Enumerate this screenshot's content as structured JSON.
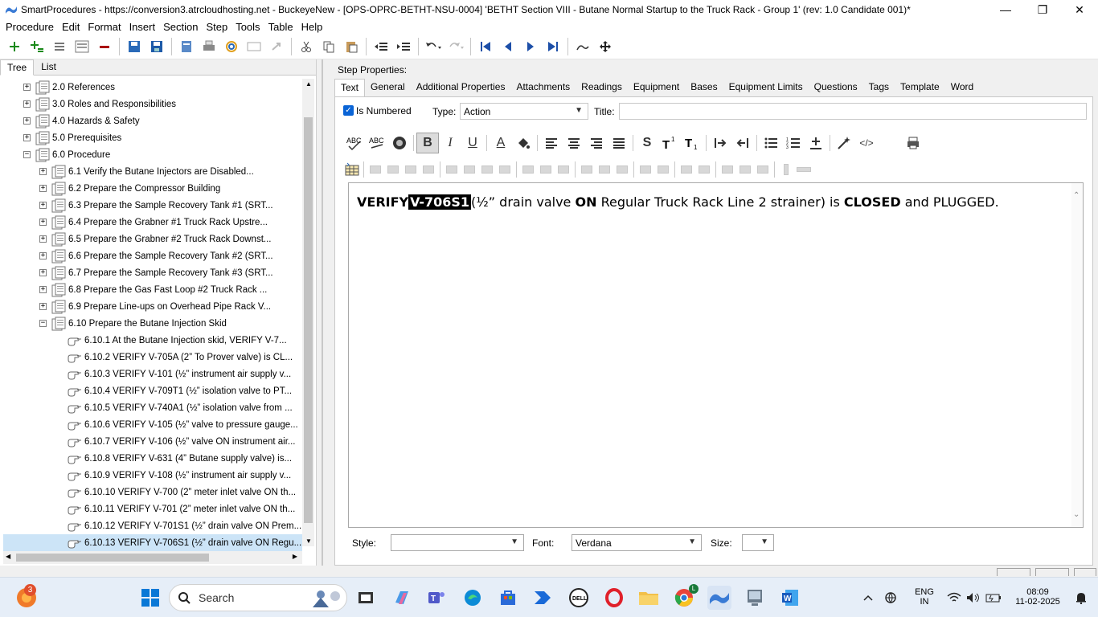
{
  "window": {
    "title": "SmartProcedures - https://conversion3.atrcloudhosting.net - BuckeyeNew - [OPS-OPRC-BETHT-NSU-0004] 'BETHT Section VIII - Butane Normal Startup to the Truck Rack - Group 1' (rev: 1.0 Candidate 001)*",
    "minimize": "—",
    "restore": "❐",
    "close": "✕"
  },
  "menu": [
    {
      "label": "Procedure"
    },
    {
      "label": "Edit"
    },
    {
      "label": "Format"
    },
    {
      "label": "Insert"
    },
    {
      "label": "Section"
    },
    {
      "label": "Step"
    },
    {
      "label": "Tools"
    },
    {
      "label": "Table"
    },
    {
      "label": "Help"
    }
  ],
  "left_tabs": [
    {
      "label": "Tree",
      "active": true
    },
    {
      "label": "List",
      "active": false
    }
  ],
  "tree": [
    {
      "indent": 0,
      "exp": "+",
      "label": "2.0 References",
      "kind": "doc"
    },
    {
      "indent": 0,
      "exp": "+",
      "label": "3.0 Roles and Responsibilities",
      "kind": "doc"
    },
    {
      "indent": 0,
      "exp": "+",
      "label": "4.0 Hazards & Safety",
      "kind": "doc"
    },
    {
      "indent": 0,
      "exp": "+",
      "label": "5.0 Prerequisites",
      "kind": "doc"
    },
    {
      "indent": 0,
      "exp": "−",
      "label": "6.0 Procedure",
      "kind": "doc"
    },
    {
      "indent": 1,
      "exp": "+",
      "label": "6.1 Verify the Butane Injectors are Disabled...",
      "kind": "doc"
    },
    {
      "indent": 1,
      "exp": "+",
      "label": "6.2 Prepare the Compressor Building",
      "kind": "doc"
    },
    {
      "indent": 1,
      "exp": "+",
      "label": "6.3 Prepare the Sample Recovery Tank #1 (SRT...",
      "kind": "doc"
    },
    {
      "indent": 1,
      "exp": "+",
      "label": "6.4 Prepare the Grabner #1 Truck Rack Upstre...",
      "kind": "doc"
    },
    {
      "indent": 1,
      "exp": "+",
      "label": "6.5 Prepare the Grabner #2 Truck Rack Downst...",
      "kind": "doc"
    },
    {
      "indent": 1,
      "exp": "+",
      "label": "6.6 Prepare the Sample Recovery Tank #2 (SRT...",
      "kind": "doc"
    },
    {
      "indent": 1,
      "exp": "+",
      "label": "6.7 Prepare the Sample Recovery Tank #3 (SRT...",
      "kind": "doc"
    },
    {
      "indent": 1,
      "exp": "+",
      "label": "6.8 Prepare the Gas Fast Loop #2 Truck Rack ...",
      "kind": "doc"
    },
    {
      "indent": 1,
      "exp": "+",
      "label": "6.9 Prepare Line-ups on Overhead Pipe Rack V...",
      "kind": "doc"
    },
    {
      "indent": 1,
      "exp": "−",
      "label": "6.10 Prepare the Butane Injection Skid",
      "kind": "doc"
    },
    {
      "indent": 2,
      "exp": "",
      "label": "6.10.1 At the Butane Injection skid, VERIFY V-7...",
      "kind": "hand"
    },
    {
      "indent": 2,
      "exp": "",
      "label": "6.10.2 VERIFY V-705A (2” To Prover valve) is CL...",
      "kind": "hand"
    },
    {
      "indent": 2,
      "exp": "",
      "label": "6.10.3 VERIFY V-101 (½” instrument air supply v...",
      "kind": "hand"
    },
    {
      "indent": 2,
      "exp": "",
      "label": "6.10.4 VERIFY V-709T1 (½” isolation valve to PT...",
      "kind": "hand"
    },
    {
      "indent": 2,
      "exp": "",
      "label": "6.10.5 VERIFY V-740A1 (½” isolation valve from ...",
      "kind": "hand"
    },
    {
      "indent": 2,
      "exp": "",
      "label": "6.10.6 VERIFY V-105 (½” valve to pressure gauge...",
      "kind": "hand"
    },
    {
      "indent": 2,
      "exp": "",
      "label": "6.10.7 VERIFY V-106 (½” valve ON instrument air...",
      "kind": "hand"
    },
    {
      "indent": 2,
      "exp": "",
      "label": "6.10.8 VERIFY V-631 (4” Butane supply valve) is...",
      "kind": "hand"
    },
    {
      "indent": 2,
      "exp": "",
      "label": "6.10.9 VERIFY V-108 (½” instrument air supply v...",
      "kind": "hand"
    },
    {
      "indent": 2,
      "exp": "",
      "label": "6.10.10 VERIFY V-700 (2” meter inlet valve ON th...",
      "kind": "hand"
    },
    {
      "indent": 2,
      "exp": "",
      "label": "6.10.11 VERIFY V-701 (2” meter inlet valve ON th...",
      "kind": "hand"
    },
    {
      "indent": 2,
      "exp": "",
      "label": "6.10.12 VERIFY V-701S1 (½” drain valve ON Prem...",
      "kind": "hand"
    },
    {
      "indent": 2,
      "exp": "",
      "label": "6.10.13 VERIFY V-706S1 (½” drain valve ON Regu...",
      "kind": "hand",
      "selected": true
    }
  ],
  "step_properties": {
    "label": "Step Properties:",
    "tabs": [
      {
        "label": "Text",
        "active": true
      },
      {
        "label": "General"
      },
      {
        "label": "Additional Properties"
      },
      {
        "label": "Attachments"
      },
      {
        "label": "Readings"
      },
      {
        "label": "Equipment"
      },
      {
        "label": "Bases"
      },
      {
        "label": "Equipment Limits"
      },
      {
        "label": "Questions"
      },
      {
        "label": "Tags"
      },
      {
        "label": "Template"
      },
      {
        "label": "Word"
      }
    ],
    "is_numbered_label": "Is Numbered",
    "is_numbered": true,
    "type_label": "Type:",
    "type_value": "Action",
    "title_label": "Title:",
    "title_value": ""
  },
  "editor": {
    "parts": [
      {
        "text": "VERIFY",
        "style": "bold"
      },
      {
        "text": "V-706S1",
        "style": "highlight"
      },
      {
        "text": "(½” drain valve ",
        "style": "normal"
      },
      {
        "text": "ON",
        "style": "bold"
      },
      {
        "text": " Regular Truck Rack Line 2 strainer) is ",
        "style": "normal"
      },
      {
        "text": "CLOSED",
        "style": "bold"
      },
      {
        "text": " and PLUGGED.",
        "style": "normal"
      }
    ]
  },
  "bottom_fields": {
    "style_label": "Style:",
    "style_value": "",
    "font_label": "Font:",
    "font_value": "Verdana",
    "size_label": "Size:",
    "size_value": ""
  },
  "taskbar": {
    "search_label": "Search",
    "notification_count": "3",
    "lang_1": "ENG",
    "lang_2": "IN",
    "time": "08:09",
    "date": "11-02-2025",
    "chrome_badge": "L"
  },
  "colors": {
    "accent": "#0a64d6",
    "selected_row": "#cce4f7",
    "highlight_bg": "#000000"
  }
}
